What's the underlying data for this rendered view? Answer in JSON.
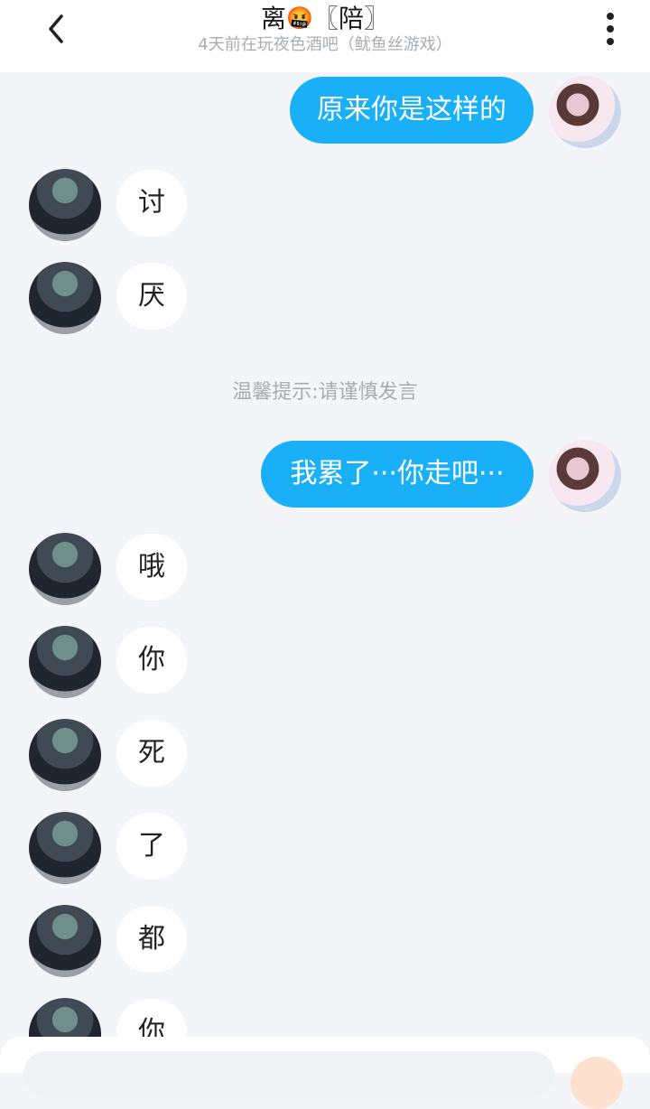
{
  "header": {
    "title_name": "离",
    "title_emoji": "🤬",
    "title_tag": "〖陪〗",
    "subtitle": "4天前在玩夜色酒吧（鱿鱼丝游戏）",
    "back_icon": "chevron-left-icon",
    "more_icon": "vertical-ellipsis-icon"
  },
  "messages": [
    {
      "from": "me",
      "text": "原来你是这样的"
    },
    {
      "from": "other",
      "text": "讨"
    },
    {
      "from": "other",
      "text": "厌"
    },
    {
      "notice": "温馨提示:请谨慎发言"
    },
    {
      "from": "me",
      "text": "我累了···你走吧···"
    },
    {
      "from": "other",
      "text": "哦"
    },
    {
      "from": "other",
      "text": "你"
    },
    {
      "from": "other",
      "text": "死"
    },
    {
      "from": "other",
      "text": "了"
    },
    {
      "from": "other",
      "text": "都"
    },
    {
      "from": "other",
      "text": "你"
    }
  ],
  "colors": {
    "outgoing_bubble": "#1ab0f7",
    "incoming_bubble": "#ffffff",
    "background": "#f4f5f8"
  }
}
